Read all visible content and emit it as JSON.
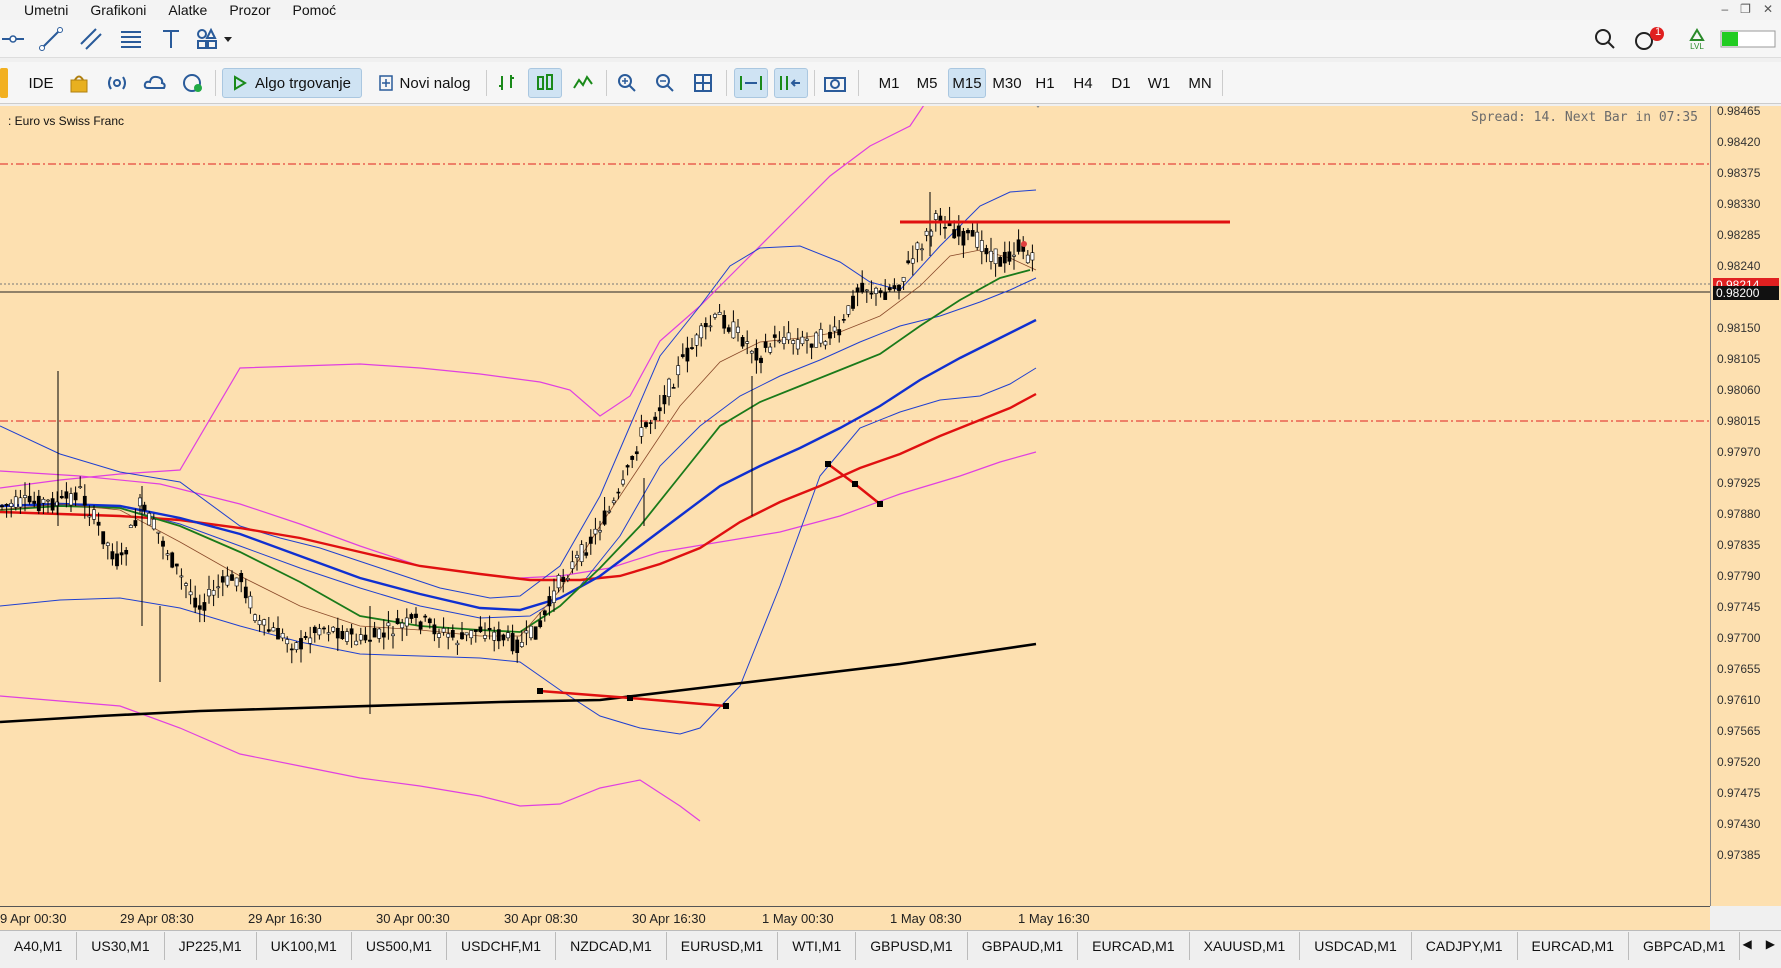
{
  "menu": [
    "Umetni",
    "Grafikoni",
    "Alatke",
    "Prozor",
    "Pomoć"
  ],
  "toolbar": {
    "ide_label": "IDE",
    "algo_label": "Algo trgovanje",
    "order_label": "Novi nalog",
    "timeframes": [
      "M1",
      "M5",
      "M15",
      "M30",
      "H1",
      "H4",
      "D1",
      "W1",
      "MN"
    ],
    "active_timeframe": "M15",
    "notification_count": "1",
    "lvl_label": "LVL"
  },
  "chart": {
    "title": ": Euro vs Swiss Franc",
    "spread_text": "Spread: 14. Next Bar in 07:35",
    "price_ticks": [
      "0.98465",
      "0.98420",
      "0.98375",
      "0.98330",
      "0.98285",
      "0.98240",
      "0.98150",
      "0.98105",
      "0.98060",
      "0.98015",
      "0.97970",
      "0.97925",
      "0.97880",
      "0.97835",
      "0.97790",
      "0.97745",
      "0.97700",
      "0.97655",
      "0.97610",
      "0.97565",
      "0.97520",
      "0.97475",
      "0.97430",
      "0.97385"
    ],
    "ask_badge": "0.98214",
    "bid_badge": "0.98200",
    "time_ticks": [
      "9 Apr 00:30",
      "29 Apr 08:30",
      "29 Apr 16:30",
      "30 Apr 00:30",
      "30 Apr 08:30",
      "30 Apr 16:30",
      "1 May 00:30",
      "1 May 08:30",
      "1 May 16:30"
    ]
  },
  "tabs": [
    "A40,M1",
    "US30,M1",
    "JP225,M1",
    "UK100,M1",
    "US500,M1",
    "USDCHF,M1",
    "NZDCAD,M1",
    "EURUSD,M1",
    "WTI,M1",
    "GBPUSD,M1",
    "GBPAUD,M1",
    "EURCAD,M1",
    "XAUUSD,M1",
    "USDCAD,M1",
    "CADJPY,M1",
    "EURCAD,M1",
    "GBPCAD,M1"
  ],
  "colors": {
    "chart_bg": "#fde0b0",
    "ema_fast": "#1a7a1a",
    "ema_mid": "#1030d0",
    "ema_slow": "#e01010",
    "band_outer": "#e040e0",
    "band_inner": "#2040d0",
    "long_ma": "#000000"
  }
}
